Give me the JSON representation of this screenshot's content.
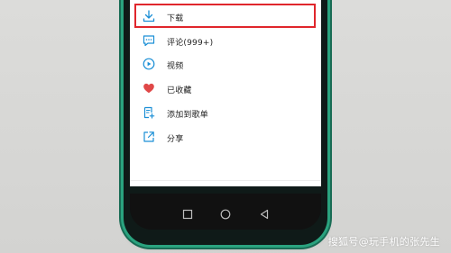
{
  "menu": {
    "items": [
      {
        "label": "下载",
        "icon": "download-icon"
      },
      {
        "label": "评论(999+)",
        "icon": "comment-icon"
      },
      {
        "label": "视频",
        "icon": "video-icon"
      },
      {
        "label": "已收藏",
        "icon": "heart-icon"
      },
      {
        "label": "添加到歌单",
        "icon": "add-to-playlist-icon"
      },
      {
        "label": "分享",
        "icon": "share-icon"
      }
    ]
  },
  "nav": {
    "buttons": [
      "recent-apps",
      "home",
      "back"
    ]
  },
  "watermark": "搜狐号@玩手机的张先生",
  "colors": {
    "accent": "#1b8fd6",
    "highlight": "#e0262c",
    "heart": "#e04848",
    "phone_frame": "#2aa37f"
  }
}
